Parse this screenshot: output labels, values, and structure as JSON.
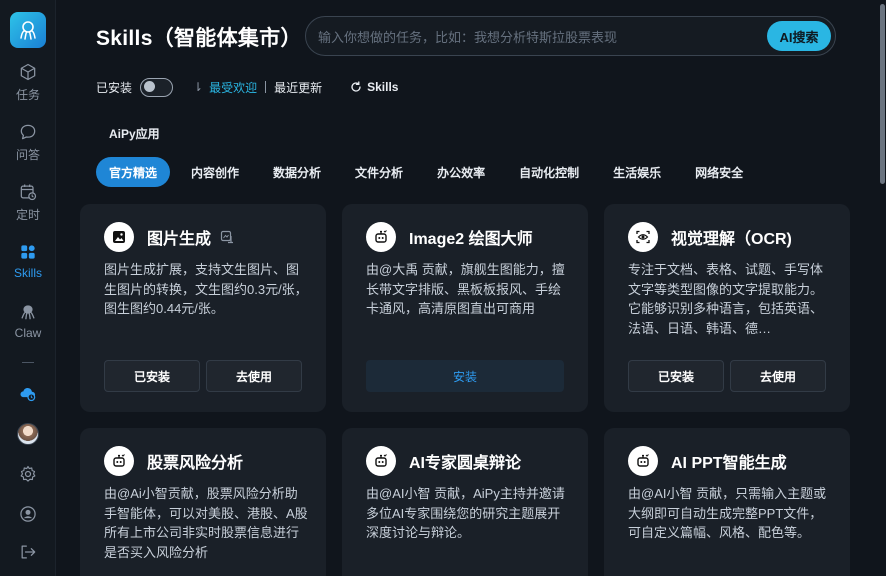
{
  "sidebar": {
    "items": [
      {
        "label": "任务",
        "icon": "cube-icon"
      },
      {
        "label": "问答",
        "icon": "chat-bubble-icon"
      },
      {
        "label": "定时",
        "icon": "calendar-clock-icon"
      },
      {
        "label": "Skills",
        "icon": "grid-apps-icon",
        "active": true
      },
      {
        "label": "Claw",
        "icon": "octopus-icon"
      }
    ],
    "bottom_icons": [
      "cloud-sync-icon",
      "avatar",
      "settings-gear-icon",
      "user-circle-icon",
      "logout-icon"
    ]
  },
  "header": {
    "title": "Skills（智能体集市）",
    "search_placeholder": "输入你想做的任务，比如：我想分析特斯拉股票表现",
    "search_button": "AI搜索"
  },
  "filters": {
    "installed_label": "已安装",
    "installed_on": false,
    "sort_popular": "最受欢迎",
    "sort_recent": "最近更新",
    "skills_link": "Skills"
  },
  "section_title": "AiPy应用",
  "tabs": [
    "官方精选",
    "内容创作",
    "数据分析",
    "文件分析",
    "办公效率",
    "自动化控制",
    "生活娱乐",
    "网络安全"
  ],
  "active_tab": "官方精选",
  "cards": [
    {
      "title": "图片生成",
      "desc": "图片生成扩展，支持文生图片、图生图片的转换，文生图约0.3元/张，图生图约0.44元/张。",
      "buttons": [
        "已安装",
        "去使用"
      ],
      "icon": "image-icon",
      "has_badge": true
    },
    {
      "title": "Image2 绘图大师",
      "desc": "由@大禹 贡献，旗舰生图能力，擅长带文字排版、黑板板报风、手绘卡通风，高清原图直出可商用",
      "buttons": [
        "安装"
      ],
      "icon": "robot-icon"
    },
    {
      "title": "视觉理解（OCR)",
      "desc": "专注于文档、表格、试题、手写体文字等类型图像的文字提取能力。它能够识别多种语言，包括英语、法语、日语、韩语、德…",
      "buttons": [
        "已安装",
        "去使用"
      ],
      "icon": "scan-eye-icon"
    },
    {
      "title": "股票风险分析",
      "desc": "由@Ai小智贡献，股票风险分析助手智能体，可以对美股、港股、A股所有上市公司非实时股票信息进行是否买入风险分析",
      "buttons": [],
      "icon": "robot-icon"
    },
    {
      "title": "AI专家圆桌辩论",
      "desc": "由@AI小智 贡献，AiPy主持并邀请多位AI专家围绕您的研究主题展开深度讨论与辩论。",
      "buttons": [],
      "icon": "robot-icon"
    },
    {
      "title": "AI PPT智能生成",
      "desc": "由@AI小智 贡献，只需输入主题或大纲即可自动生成完整PPT文件，可自定义篇幅、风格、配色等。",
      "buttons": [],
      "icon": "robot-icon"
    }
  ],
  "colors": {
    "accent": "#2ab6e3",
    "active_tab": "#1f86d6",
    "card_bg": "#1a2028",
    "page_bg": "#10151c"
  }
}
